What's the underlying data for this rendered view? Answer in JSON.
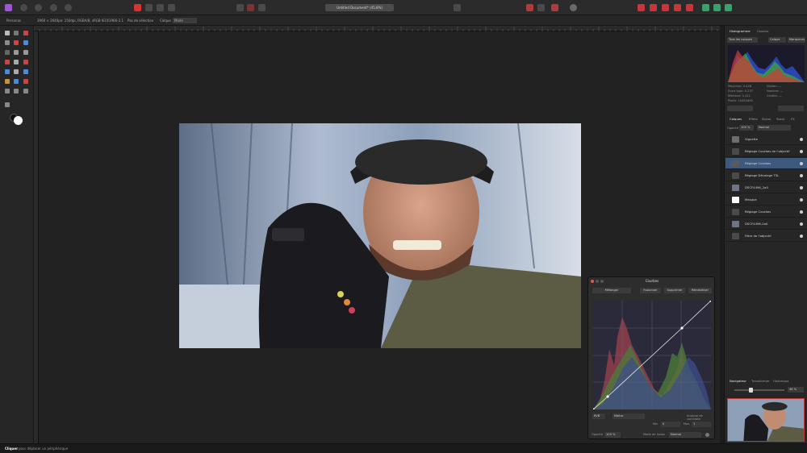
{
  "document": {
    "title": "Untitled Document* (45.8%)"
  },
  "context_bar": {
    "personas_label": "Personas",
    "size_info": "3960 × 2640px: 150dpi, RGBA/8, sRGB IEC61966-2.1",
    "no_selection": "Pas de sélection",
    "mode_label": "Calque",
    "mode_value": "Mode"
  },
  "curves_dialog": {
    "title": "Courbes",
    "buttons": {
      "merge": "Mélanger",
      "fusion": "Fusionner",
      "delete": "Supprimer",
      "reset": "Réinitialiser"
    },
    "channel": "RVB",
    "mode": "Maître",
    "auto_contrast": "Analyse de contraste",
    "opacity_label": "Opacité",
    "opacity_value": "100 %",
    "blend_label": "Mode de fusion",
    "blend_value": "Normal",
    "min_label": "Min",
    "min_value": "0",
    "max_label": "Max",
    "max_value": "1"
  },
  "right_panel": {
    "top_tabs": [
      "Histogramme",
      "Couleur"
    ],
    "histogram_options": {
      "layer_label": "Tous les calques",
      "btn1": "Calque",
      "btn2": "Marqueurs"
    },
    "stats_left": [
      "Moyenne: 0.428",
      "Écart type: 0.237",
      "Médiane: 0.412",
      "Pixels: 10454400"
    ],
    "stats_right": [
      "Niveau: —",
      "Nombre: —",
      "Centile: —"
    ],
    "layers_tabs": [
      "Calques",
      "Effets",
      "Styles",
      "Stock",
      "FX"
    ],
    "opacity_label": "Opacité",
    "opacity_value": "100 %",
    "blend_value": "Normal",
    "layers": [
      {
        "name": "Vignette",
        "color": "#6d6d6d",
        "selected": false
      },
      {
        "name": "Réglage Courbes de l'objectif",
        "color": "#4a4a4a",
        "selected": false
      },
      {
        "name": "Réglage Courbes",
        "color": "#5a5a5a",
        "selected": true
      },
      {
        "name": "Réglage Décalage TSL",
        "color": "#4a4a4a",
        "selected": false
      },
      {
        "name": "DSCF4496_2a0",
        "color": "#6a7686",
        "selected": false
      },
      {
        "name": "Masque",
        "color": "#ffffff",
        "selected": false
      },
      {
        "name": "Réglage Courbes",
        "color": "#4a4a4a",
        "selected": false
      },
      {
        "name": "DSCF4496-2a0",
        "color": "#6a7686",
        "selected": false
      },
      {
        "name": "Filtre de l'objectif",
        "color": "#4a4a4a",
        "selected": false
      }
    ],
    "navigator_tabs": [
      "Navigateur",
      "Transformer",
      "Historique"
    ],
    "zoom_value": "46 %"
  },
  "status_bar": {
    "message_bold": "Cliquer",
    "message": "pour déplacer un périphérique"
  },
  "colors": {
    "selected_layer": "#3d5a7e",
    "accent_red": "#d8342f",
    "accent_green": "#3ca06a"
  }
}
